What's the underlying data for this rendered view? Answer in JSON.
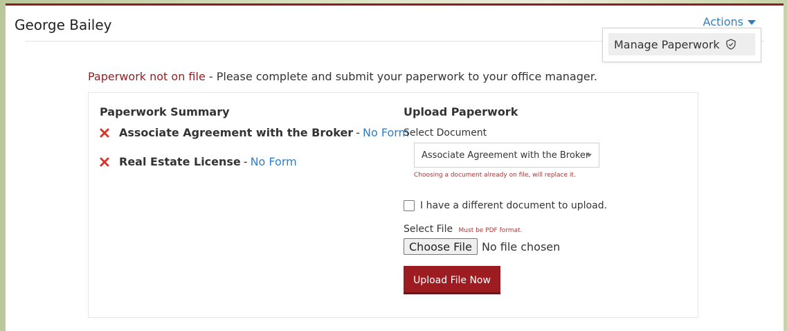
{
  "agent": {
    "name": "George Bailey"
  },
  "actions": {
    "label": "Actions",
    "menu": {
      "manage_paperwork": "Manage Paperwork"
    }
  },
  "notice": {
    "status": "Paperwork not on file",
    "message": " - Please complete and submit your paperwork to your office manager."
  },
  "summary": {
    "title": "Paperwork Summary",
    "items": [
      {
        "name": "Associate Agreement with the Broker",
        "separator": "-",
        "status": "No Form",
        "icon": "x-icon"
      },
      {
        "name": "Real Estate License",
        "separator": "-",
        "status": "No Form",
        "icon": "x-icon"
      }
    ]
  },
  "upload": {
    "title": "Upload Paperwork",
    "select_label": "Select Document",
    "selected_document": "Associate Agreement with the Broker",
    "replace_note": "Choosing a document already on file, will replace it.",
    "checkbox_label": "I have a different document to upload.",
    "checkbox_checked": false,
    "file_label": "Select File",
    "file_note": "Must be PDF format.",
    "choose_button": "Choose File",
    "file_status": "No file chosen",
    "submit_button": "Upload File Now"
  },
  "colors": {
    "brand_red": "#9c1c22",
    "link_blue": "#2d7fc4"
  }
}
